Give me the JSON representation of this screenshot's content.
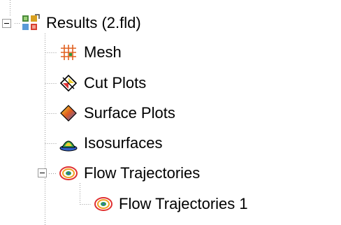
{
  "tree": {
    "root": {
      "label": "Results (2.fld)",
      "icon": "results-icon",
      "expanded": true
    },
    "children": [
      {
        "label": "Mesh",
        "icon": "mesh-icon"
      },
      {
        "label": "Cut Plots",
        "icon": "cut-plots-icon"
      },
      {
        "label": "Surface Plots",
        "icon": "surface-plots-icon"
      },
      {
        "label": "Isosurfaces",
        "icon": "isosurfaces-icon"
      },
      {
        "label": "Flow Trajectories",
        "icon": "flow-trajectories-icon",
        "expanded": true,
        "children": [
          {
            "label": "Flow Trajectories 1",
            "icon": "flow-trajectories-icon"
          }
        ]
      }
    ]
  },
  "colors": {
    "line": "#9a9a9a",
    "expander_border": "#9a9a9a",
    "text": "#000000",
    "background": "#ffffff"
  }
}
